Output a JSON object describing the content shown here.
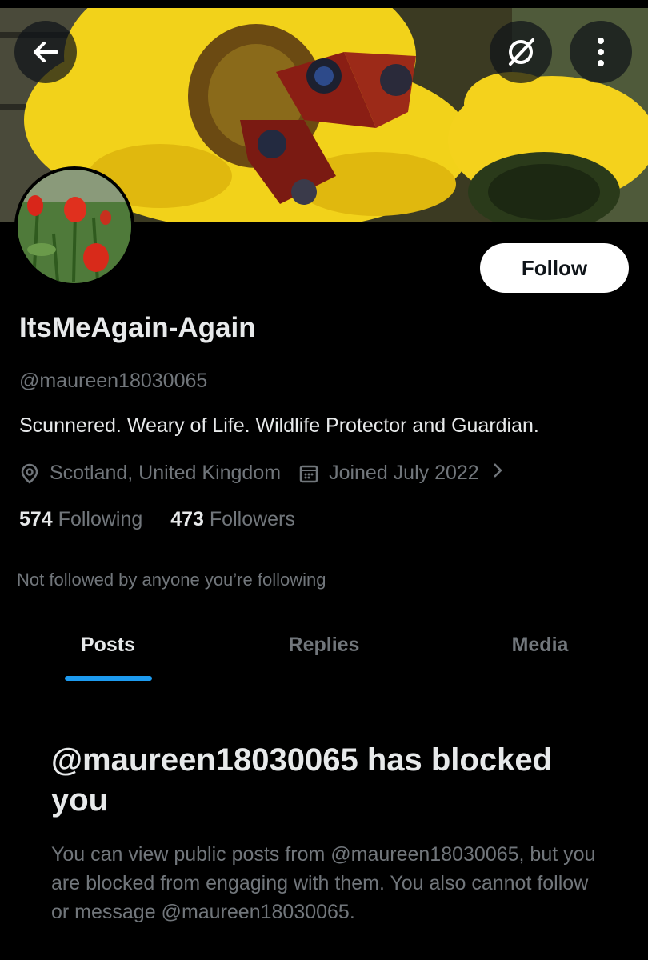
{
  "header": {
    "back_icon": "arrow-left-icon",
    "grok_icon": "slash-circle-icon",
    "more_icon": "vertical-dots-icon"
  },
  "profile": {
    "follow_label": "Follow",
    "display_name": "ItsMeAgain-Again",
    "handle": "@maureen18030065",
    "bio": "Scunnered. Weary of Life.  Wildlife Protector and Guardian.",
    "location": "Scotland, United Kingdom",
    "joined": "Joined July 2022",
    "following_count": "574",
    "following_label": "Following",
    "followers_count": "473",
    "followers_label": "Followers",
    "not_followed_text": "Not followed by anyone you’re following"
  },
  "tabs": [
    {
      "label": "Posts"
    },
    {
      "label": "Replies"
    },
    {
      "label": "Media"
    }
  ],
  "blocked": {
    "title": "@maureen18030065 has blocked you",
    "description": "You can view public posts from @maureen18030065, but you are blocked from engaging with them. You also cannot follow or message @maureen18030065."
  },
  "colors": {
    "background": "#000000",
    "accent": "#1d9bf0",
    "secondary_text": "#71767b"
  }
}
